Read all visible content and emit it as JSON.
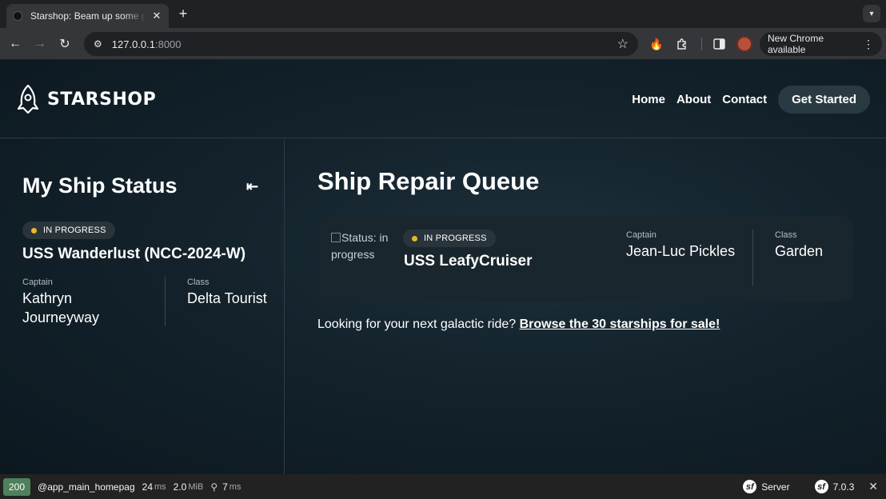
{
  "browser": {
    "tab_title": "Starshop: Beam up some parts",
    "url_host": "127.0.0.1",
    "url_port": ":8000",
    "update_label": "New Chrome available",
    "icons": [
      "back-icon",
      "forward-icon",
      "reload-icon",
      "site-settings-icon",
      "bookmark-star-icon",
      "extension-flame-icon",
      "extensions-puzzle-icon",
      "side-panel-icon",
      "profile-avatar",
      "menu-dots-icon"
    ]
  },
  "site": {
    "brand": "STARSHOP",
    "nav": [
      "Home",
      "About",
      "Contact"
    ],
    "cta": "Get Started"
  },
  "sidebar": {
    "title": "My Ship Status",
    "collapse_glyph": "⇤",
    "status": "IN PROGRESS",
    "ship_name": "USS Wanderlust (NCC-2024-W)",
    "captain_label": "Captain",
    "captain_value": "Kathryn Journeyway",
    "class_label": "Class",
    "class_value": "Delta Tourist"
  },
  "main": {
    "title": "Ship Repair Queue",
    "card": {
      "image_alt": "Status: in progress",
      "status": "IN PROGRESS",
      "ship_name": "USS LeafyCruiser",
      "captain_label": "Captain",
      "captain_value": "Jean-Luc Pickles",
      "class_label": "Class",
      "class_value": "Garden"
    },
    "promo_text": "Looking for your next galactic ride?",
    "promo_link": "Browse the 30 starships for sale!"
  },
  "profiler": {
    "status_code": "200",
    "route": "@app_main_homepag",
    "time_value": "24",
    "time_unit": "ms",
    "memory_value": "2.0",
    "memory_unit": "MiB",
    "events_value": "7",
    "events_unit": "ms",
    "server_label": "Server",
    "version": "7.0.3"
  },
  "colors": {
    "status_dot": "#e8b82a",
    "profiler_ok": "#4f805d",
    "page_bg": "#13222b"
  }
}
